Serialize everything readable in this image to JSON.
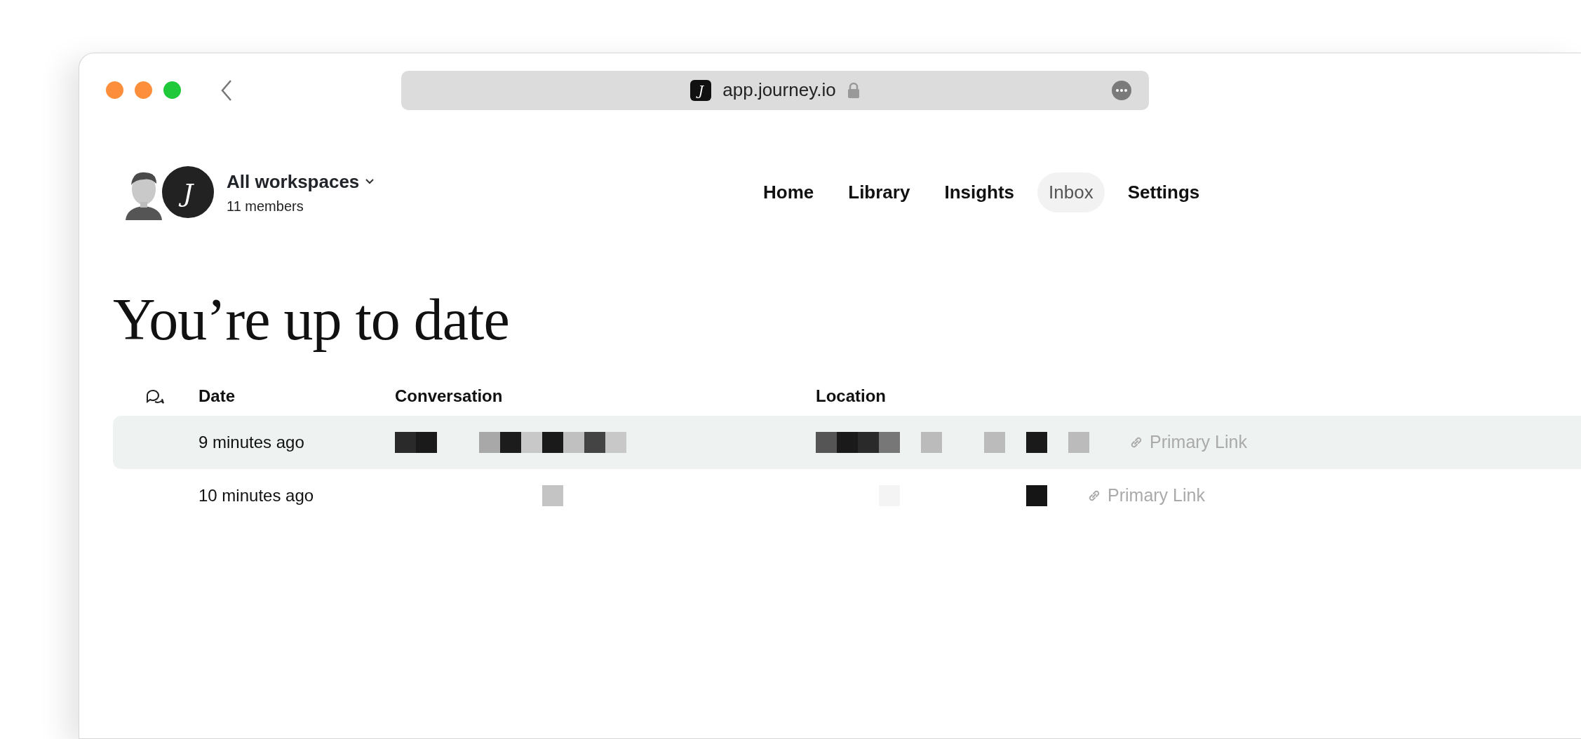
{
  "browser": {
    "favicon_letter": "J",
    "url": "app.journey.io"
  },
  "workspace": {
    "logo_letter": "J",
    "name": "All workspaces",
    "members": "11 members"
  },
  "nav": [
    {
      "label": "Home",
      "selected": false
    },
    {
      "label": "Library",
      "selected": false
    },
    {
      "label": "Insights",
      "selected": false
    },
    {
      "label": "Inbox",
      "selected": true
    },
    {
      "label": "Settings",
      "selected": false
    }
  ],
  "heading": "You’re up to date",
  "table": {
    "columns": [
      "Date",
      "Conversation",
      "Location"
    ],
    "rows": [
      {
        "date": "9 minutes ago",
        "link": "Primary Link",
        "highlighted": true
      },
      {
        "date": "10 minutes ago",
        "link": "Primary Link",
        "highlighted": false
      }
    ]
  }
}
